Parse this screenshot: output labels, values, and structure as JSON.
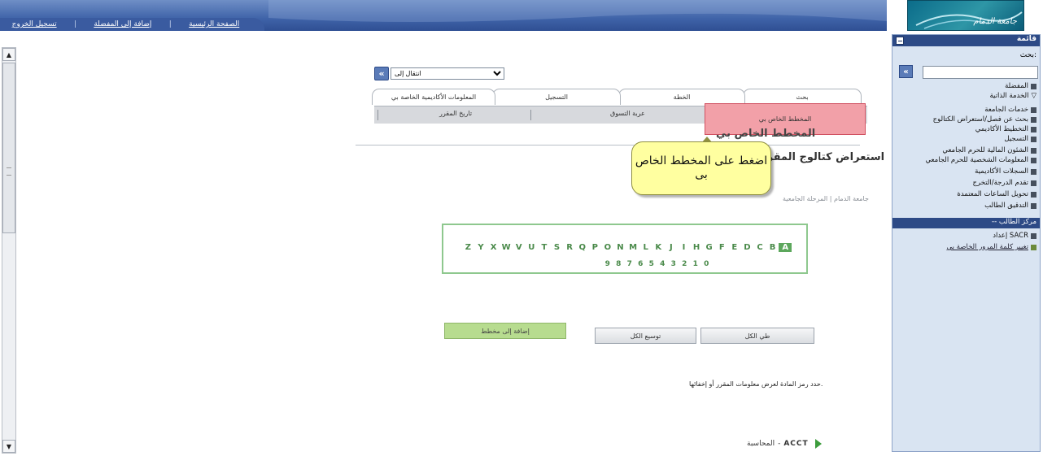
{
  "header": {
    "links": [
      "تسجيل الخروج",
      "إضافة إلى المفضلة",
      "الصفحة الرئيسية"
    ],
    "logo_text": "جامعة الدمام"
  },
  "main": {
    "goto_label": "انتقال إلى",
    "tabs": [
      "بحث",
      "الخطة",
      "التسجيل",
      "المعلومات الأكاديمية الخاصة بي"
    ],
    "subtabs": [
      "المخطط الخاص بي",
      "عربة التسوق",
      "تاريخ المقرر"
    ],
    "page_heading": "المخطط الخاص بي",
    "browse_title": "استعراض كتالوج المقرر",
    "crumbs": "جامعة الدمام | المرحلة الجامعية",
    "callout": "اضغط على المخطط الخاص بى",
    "letters": [
      "Z",
      "Y",
      "X",
      "W",
      "V",
      "U",
      "T",
      "S",
      "R",
      "Q",
      "P",
      "O",
      "N",
      "M",
      "L",
      "K",
      "J",
      "I",
      "H",
      "G",
      "F",
      "E",
      "D",
      "C",
      "B",
      "A"
    ],
    "digits": [
      "9",
      "8",
      "7",
      "6",
      "5",
      "4",
      "3",
      "2",
      "1",
      "0"
    ],
    "buttons": {
      "add_to_plan": "إضافة إلى مخطط",
      "expand_all": "توسيع الكل",
      "collapse_all": "طي الكل"
    },
    "hint": "حدد رمز المادة لعرض معلومات المقرر أو إخفائها.",
    "subject": {
      "code": "ACCT",
      "separator": "-",
      "name": "المحاسبة"
    }
  },
  "menu": {
    "title": "قائمة",
    "search_label": "بحث:",
    "items": [
      "المفضلة",
      "الخدمة الذاتية",
      "خدمات الجامعة",
      "بحث عن فصل/استعراض الكتالوج",
      "التخطيط الأكاديمي",
      "التسجيل",
      "الشئون المالية للحرم الجامعي",
      "المعلومات الشخصية للحرم الجامعي",
      "السجلات الأكاديمية",
      "تقدم الدرجة/التخرج",
      "تحويل الساعات المعتمدة",
      "التدقيق الطالب"
    ],
    "center": "-- مركز الطالب",
    "extra_items": [
      "إعداد SACR",
      "تغيير كلمة المرور الخاصة بي"
    ]
  },
  "colors": {
    "header_blue": "#3f63a8",
    "menu_bg": "#d9e4f2",
    "active_subtab": "#f2a0a8",
    "callout": "#ffffa0",
    "alpha_green": "#4a8a4a",
    "add_button_green": "#b7dc8f"
  }
}
